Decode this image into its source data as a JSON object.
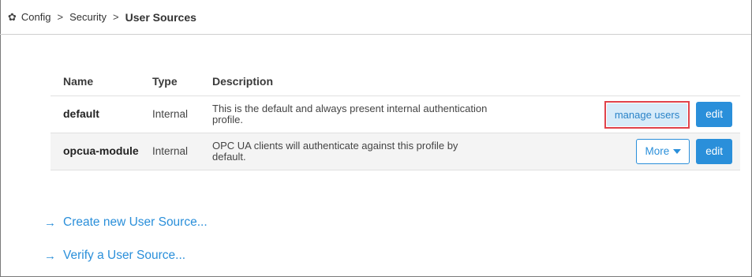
{
  "breadcrumb": {
    "icon": "gear-icon",
    "items": [
      "Config",
      "Security"
    ],
    "separator": ">",
    "current": "User Sources"
  },
  "table": {
    "headers": {
      "name": "Name",
      "type": "Type",
      "description": "Description"
    },
    "rows": [
      {
        "name": "default",
        "type": "Internal",
        "description_line1": "This is the default and always present internal authentication",
        "description_line2": "profile.",
        "action_primary": "manage users",
        "action_edit": "edit"
      },
      {
        "name": "opcua-module",
        "type": "Internal",
        "description_line1": "OPC UA clients will authenticate against this profile by",
        "description_line2": "default.",
        "action_primary": "More",
        "action_edit": "edit"
      }
    ]
  },
  "links": [
    {
      "arrow": "→",
      "label": "Create new User Source..."
    },
    {
      "arrow": "→",
      "label": "Verify a User Source..."
    }
  ],
  "colors": {
    "accent": "#2a8fda",
    "highlight_border": "#e0434b",
    "manage_bg": "#d7ebf9"
  }
}
